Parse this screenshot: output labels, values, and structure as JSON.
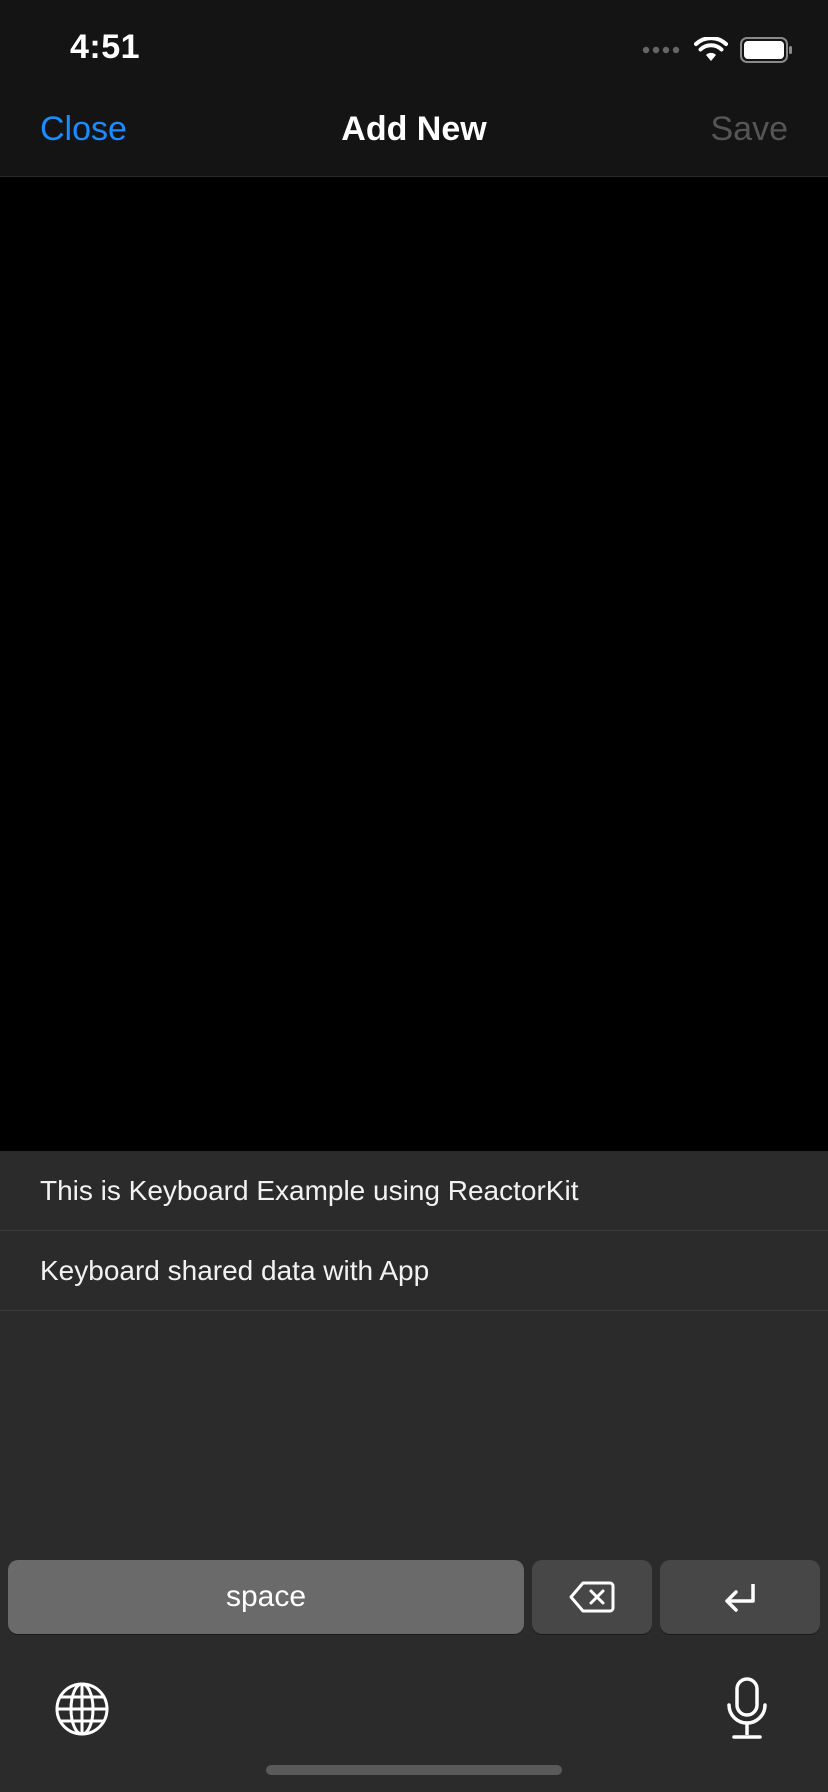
{
  "status_bar": {
    "time": "4:51"
  },
  "nav": {
    "close_label": "Close",
    "title": "Add New",
    "save_label": "Save"
  },
  "keyboard": {
    "suggestions": [
      "This is Keyboard Example using ReactorKit",
      "Keyboard shared data with App"
    ],
    "space_label": "space"
  },
  "colors": {
    "accent": "#1a8cff",
    "disabled": "#555555",
    "keyboard_bg": "#2b2b2b"
  },
  "icons": [
    "signal-icon",
    "wifi-icon",
    "battery-icon",
    "delete-icon",
    "return-icon",
    "globe-icon",
    "microphone-icon"
  ]
}
